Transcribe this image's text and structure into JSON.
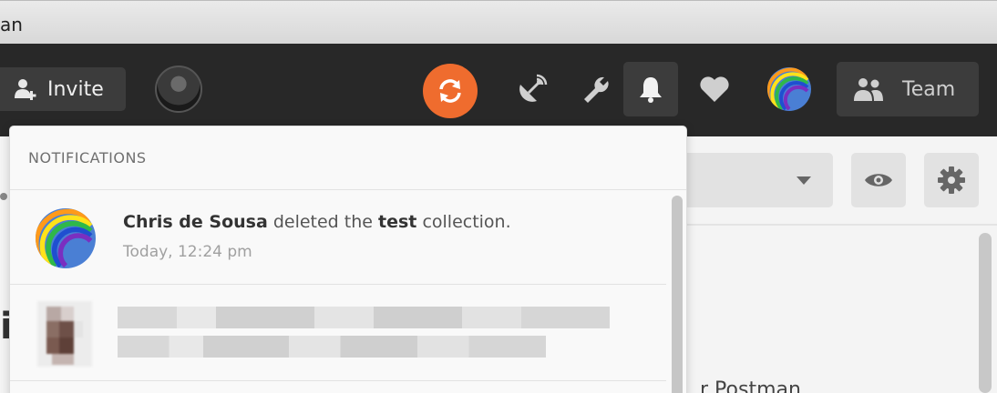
{
  "window": {
    "title": "an"
  },
  "header": {
    "invite_label": "Invite",
    "team_label": "Team",
    "sync_color": "#ef6c2e",
    "icons": [
      "invite-user-icon",
      "sync-icon",
      "satellite-icon",
      "wrench-icon",
      "bell-icon",
      "heart-icon",
      "team-icon"
    ]
  },
  "notifications": {
    "title": "NOTIFICATIONS",
    "items": [
      {
        "actor": "Chris de Sousa",
        "action": "deleted the",
        "object": "test",
        "suffix": "collection.",
        "time": "Today, 12:24 pm"
      }
    ]
  },
  "main": {
    "left_glyph": "i",
    "bottom_text": "r Postman"
  }
}
